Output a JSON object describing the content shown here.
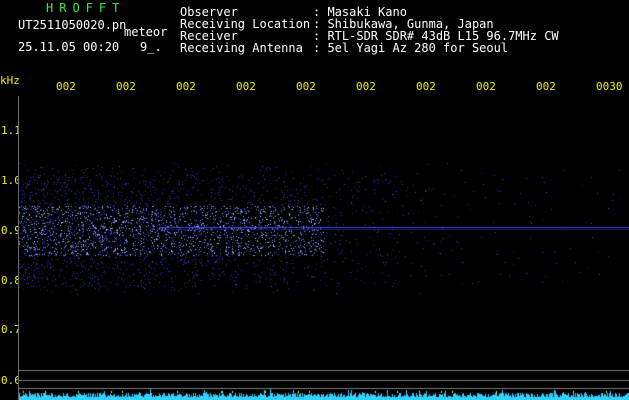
{
  "header": {
    "app_title": "HROFFT",
    "filename": "UT2511050020.pn",
    "mode": "meteor",
    "datetime": "25.11.05 00:20",
    "count": "9_.",
    "observer_label": "Observer",
    "observer_value": ": Masaki Kano",
    "location_label": "Receiving Location",
    "location_value": ": Shibukawa, Gunma, Japan",
    "receiver_label": "Receiver",
    "receiver_value": ": RTL-SDR SDR# 43dB L15 96.7MHz CW",
    "antenna_label": "Receiving Antenna",
    "antenna_value": ": 5el Yagi Az 280 for Seoul"
  },
  "axis": {
    "unit": "kHz",
    "time_ticks": [
      "002",
      "002",
      "002",
      "002",
      "002",
      "002",
      "002",
      "002",
      "002",
      "0030"
    ],
    "freq_ticks": [
      "1.1",
      "1.0",
      "0.9",
      "0.8",
      "0.7",
      "0.6"
    ]
  },
  "colors": {
    "header_green": "#3ee63e",
    "axis_yellow": "#f0f000",
    "signal_blue": "#3030ff",
    "noise_cyan": "#30d0ff"
  }
}
